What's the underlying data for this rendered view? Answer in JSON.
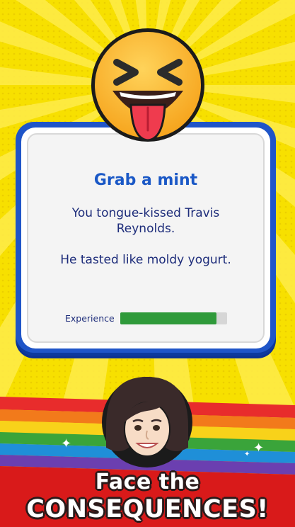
{
  "card": {
    "title": "Grab a mint",
    "body_line_1": "You tongue-kissed Travis Reynolds.",
    "body_line_2": "He tasted like moldy yogurt.",
    "experience_label": "Experience",
    "experience_progress": 0.9
  },
  "caption": {
    "line_1": "Face the",
    "line_2": "CONSEQUENCES!"
  },
  "colors": {
    "background": "#f7e000",
    "card_border": "#1f55c8",
    "title": "#1a58c6",
    "body_text": "#1d2c7a",
    "progress_fill": "#2f9a3a",
    "rainbow": [
      "#e82c2c",
      "#f27a1b",
      "#f8d21a",
      "#3aa43a",
      "#1f8fd8",
      "#6b3fb0"
    ]
  },
  "icons": {
    "emoji": "squinting-face-with-tongue-emoji",
    "avatar": "woman-avatar",
    "sparkles": "sparkle-icon"
  }
}
